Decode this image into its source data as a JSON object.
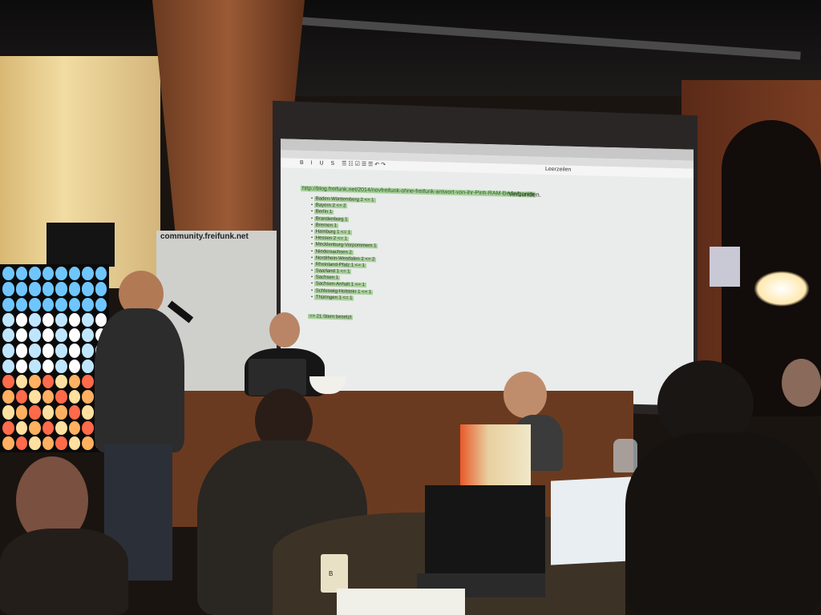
{
  "board": {
    "title": "community.freifunk.net"
  },
  "screen": {
    "toolbar": {
      "items": [
        "B",
        "I",
        "U",
        "S",
        "",
        "",
        "",
        "",
        "",
        "",
        "",
        "",
        ""
      ],
      "status": "Leerzeilen"
    },
    "link_text": "http://blog.freifunk.net/2014/novfreifunk-ohne-freifunk-antwort-von-ihr-Pinh-RAM-Berlin/geräte",
    "verbunden": "Verbunden.",
    "list": [
      "Baden-Württemberg 2 <= 1",
      "Bayern 2 <= 2",
      "Berlin 1",
      "Brandenburg 1",
      "Bremen 1",
      "Hamburg 1 <= 1",
      "Hessen 2 <= 1",
      "Mecklenburg-Vorpommern 1",
      "Niedersachsen 2",
      "Nordrhein-Westfalen 2 <= 2",
      "Rheinland-Pfalz 1 <= 1",
      "Saarland 1 <= 1",
      "Sachsen 1",
      "Sachsen-Anhalt 1 <= 1",
      "Schleswig-Holstein 1 <= 1",
      "Thüringen 1 <= 1"
    ],
    "total": "=> 21 Stern besetzt"
  },
  "cup": {
    "letter": "B"
  },
  "colors": {
    "screen_bg": "#e9eceb",
    "highlight": "#a9d19a",
    "wall": "#6a3a20"
  }
}
